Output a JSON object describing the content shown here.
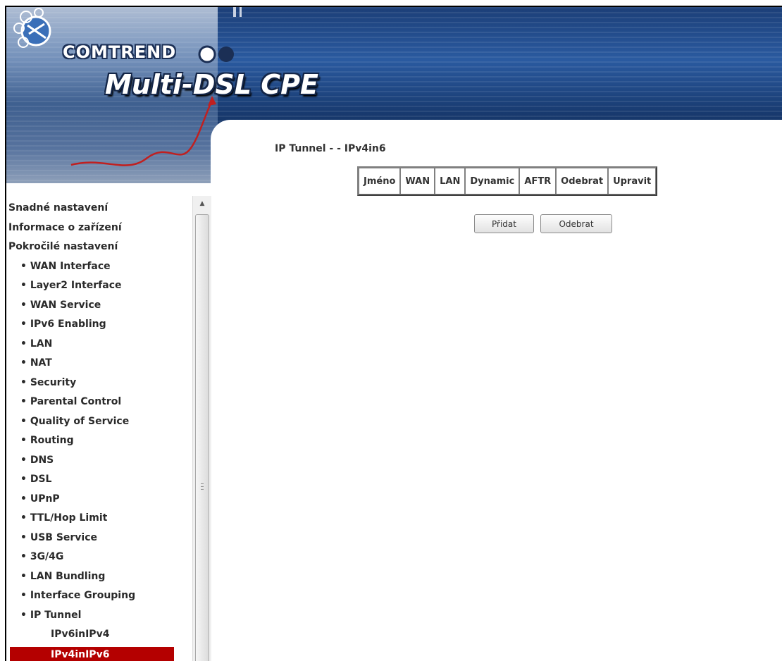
{
  "header": {
    "brand": "COMTREND",
    "product": "Multi-DSL CPE"
  },
  "main": {
    "title": "IP Tunnel - - IPv4in6",
    "table_headers": [
      "Jméno",
      "WAN",
      "LAN",
      "Dynamic",
      "AFTR",
      "Odebrat",
      "Upravit"
    ],
    "buttons": {
      "add": "Přidat",
      "remove": "Odebrat"
    }
  },
  "sidebar": {
    "items": [
      {
        "label": "Snadné nastavení",
        "level": 1
      },
      {
        "label": "Informace o zařízení",
        "level": 1
      },
      {
        "label": "Pokročilé nastavení",
        "level": 1
      },
      {
        "label": "WAN Interface",
        "level": 2
      },
      {
        "label": "Layer2 Interface",
        "level": 2
      },
      {
        "label": "WAN Service",
        "level": 2
      },
      {
        "label": "IPv6 Enabling",
        "level": 2
      },
      {
        "label": "LAN",
        "level": 2
      },
      {
        "label": "NAT",
        "level": 2
      },
      {
        "label": "Security",
        "level": 2
      },
      {
        "label": "Parental Control",
        "level": 2
      },
      {
        "label": "Quality of Service",
        "level": 2
      },
      {
        "label": "Routing",
        "level": 2
      },
      {
        "label": "DNS",
        "level": 2
      },
      {
        "label": "DSL",
        "level": 2
      },
      {
        "label": "UPnP",
        "level": 2
      },
      {
        "label": "TTL/Hop Limit",
        "level": 2
      },
      {
        "label": "USB Service",
        "level": 2
      },
      {
        "label": "3G/4G",
        "level": 2
      },
      {
        "label": "LAN Bundling",
        "level": 2
      },
      {
        "label": "Interface Grouping",
        "level": 2
      },
      {
        "label": "IP Tunnel",
        "level": 2
      },
      {
        "label": "IPv6inIPv4",
        "level": 3
      },
      {
        "label": "IPv4inIPv6",
        "level": 3,
        "active": true
      }
    ]
  },
  "colors": {
    "active_item": "#b40000",
    "banner": "#1c3f78"
  }
}
